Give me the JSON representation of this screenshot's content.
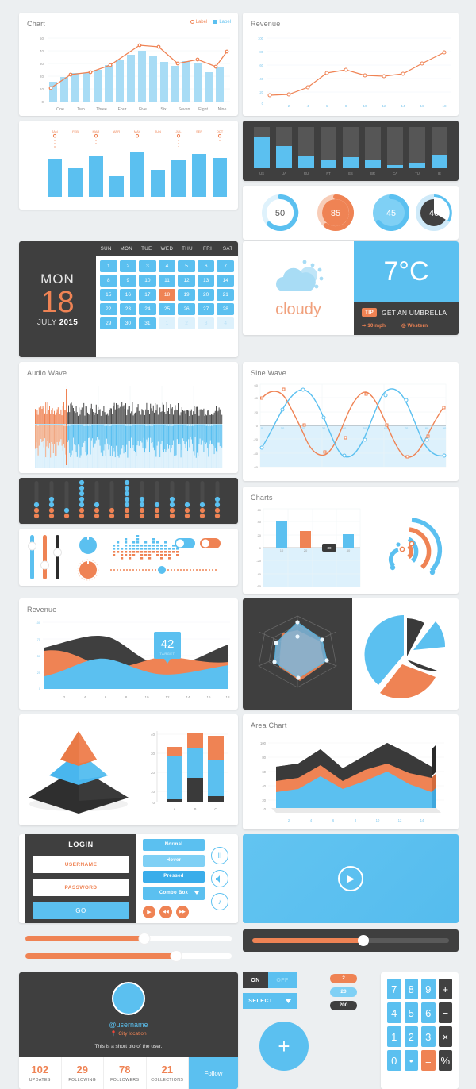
{
  "chart_panel": {
    "title": "Chart",
    "legend": [
      {
        "label": "Label",
        "style": "circle",
        "color": "#ef8354"
      },
      {
        "label": "Label",
        "style": "square",
        "color": "#5bc0f0"
      }
    ]
  },
  "chart_data": [
    {
      "type": "bar",
      "id": "chart",
      "title": "Chart",
      "categories": [
        "One",
        "Two",
        "Three",
        "Four",
        "Five",
        "Six",
        "Seven",
        "Eight",
        "Nine"
      ],
      "ytick_labels": [
        "0",
        "10",
        "20",
        "30",
        "40",
        "50"
      ],
      "ylim": [
        0,
        50
      ],
      "series": [
        {
          "name": "Label",
          "type": "bar",
          "color": "#a8dcf5",
          "values": [
            8,
            12,
            15,
            15,
            17,
            21,
            33,
            37,
            40,
            36,
            30,
            28,
            32,
            30,
            23,
            27,
            34
          ]
        },
        {
          "name": "Label",
          "type": "line",
          "color": "#ef8354",
          "values": [
            11,
            21,
            23,
            29,
            45,
            44,
            30,
            33,
            28,
            40
          ]
        }
      ],
      "xlabel": "",
      "ylabel": "",
      "grid": true,
      "legend_position": "top-right"
    },
    {
      "type": "line",
      "id": "revenue-line",
      "title": "Revenue",
      "x": [
        1,
        2,
        4,
        6,
        8,
        10,
        12,
        14,
        16,
        18
      ],
      "xtick_labels": [
        "",
        "2",
        "4",
        "6",
        "8",
        "10",
        "12",
        "14",
        "16",
        "18"
      ],
      "ytick_labels": [
        "0",
        "20",
        "40",
        "60",
        "80",
        "100"
      ],
      "ylim": [
        0,
        100
      ],
      "values": [
        11,
        13,
        24,
        46,
        50,
        43,
        41,
        44,
        58,
        72
      ],
      "color": "#ef8354",
      "grid": true
    },
    {
      "type": "bar",
      "id": "country-bars",
      "categories": [
        "US",
        "UA",
        "RU",
        "PT",
        "ES",
        "BR",
        "CA",
        "TU",
        "IE"
      ],
      "values": [
        78,
        53,
        30,
        20,
        27,
        21,
        8,
        14,
        32
      ],
      "track_max": 100,
      "bar_color": "#5bc0f0",
      "track_color": "#565656",
      "background": "#3f3f3f"
    },
    {
      "type": "gauge",
      "id": "donuts",
      "items": [
        {
          "value": 50,
          "ring": "#5bc0f0",
          "track": "#dff2fc",
          "fill": "#ffffff",
          "text": "#555555"
        },
        {
          "value": 85,
          "ring": "#ef8354",
          "track": "#f8cdb8",
          "fill": "#ef8354",
          "text": "#ffffff"
        },
        {
          "value": 45,
          "ring": "#5bc0f0",
          "track": "#7fd0f5",
          "fill": "#7fd0f5",
          "text": "#ffffff"
        },
        {
          "value": 40,
          "ring": "#5bc0f0",
          "track": "#cfeaf9",
          "fill": "#414141",
          "text": "#ffffff"
        }
      ]
    },
    {
      "type": "line",
      "id": "sine-wave",
      "title": "Sine Wave",
      "xtick_labels": [
        "0",
        "10",
        "20",
        "30",
        "40",
        "50",
        "60",
        "70",
        "80",
        "90"
      ],
      "ytick_labels": [
        "-60",
        "-40",
        "-20",
        "0",
        "20",
        "40",
        "60"
      ],
      "ylim": [
        -60,
        60
      ],
      "xlim": [
        0,
        90
      ],
      "series": [
        {
          "name": "wave-a",
          "color": "#ef8354",
          "values": [
            40,
            52,
            48,
            5,
            -42,
            -45,
            -22,
            42,
            52,
            48,
            2,
            -45,
            -46,
            -20
          ]
        },
        {
          "name": "wave-b",
          "color": "#5bc0f0",
          "values": [
            -31,
            27,
            55,
            18,
            -39,
            -41,
            -33,
            30,
            55,
            48,
            16,
            -38
          ]
        }
      ],
      "grid": true
    },
    {
      "type": "bar",
      "id": "charts-bar",
      "title": "Charts",
      "categories": [
        "10",
        "20",
        "30",
        "40"
      ],
      "values": [
        40,
        26,
        0,
        21
      ],
      "colors": [
        "#5bc0f0",
        "#ef8354",
        "#3a3a3a",
        "#5bc0f0"
      ],
      "highlighted_category": "30",
      "ytick_labels": [
        "-60",
        "-40",
        "-20",
        "0",
        "20",
        "40",
        "60"
      ],
      "ylim": [
        -60,
        60
      ],
      "grid": true
    },
    {
      "type": "area",
      "id": "revenue-area",
      "title": "Revenue",
      "xtick_labels": [
        "2",
        "4",
        "6",
        "8",
        "10",
        "12",
        "14",
        "16",
        "18"
      ],
      "ytick_labels": [
        "0",
        "25",
        "50",
        "75",
        "100"
      ],
      "ylim": [
        0,
        100
      ],
      "annotation": {
        "value": "42",
        "label": "TARGET",
        "color": "#5bc0f0"
      },
      "series": [
        {
          "name": "series-blue",
          "color": "#5bc0f0",
          "values": [
            22,
            30,
            38,
            44,
            47,
            44,
            38,
            33,
            31,
            34,
            38,
            40,
            38,
            36,
            38,
            42
          ]
        },
        {
          "name": "series-orange",
          "color": "#ef8354",
          "values": [
            52,
            50,
            46,
            42,
            40,
            42,
            44,
            41,
            36,
            46,
            52,
            50,
            44,
            40,
            44,
            50
          ]
        },
        {
          "name": "series-dark",
          "color": "#3f3f3f",
          "values": [
            52,
            50,
            48,
            50,
            58,
            66,
            70,
            68,
            60,
            52,
            50,
            50,
            48,
            50,
            56,
            62
          ]
        }
      ]
    },
    {
      "type": "radar",
      "id": "radar",
      "axes": 7,
      "series": [
        {
          "name": "radar-orange",
          "color": "#ef8354",
          "values": [
            0.45,
            0.85,
            0.55,
            0.8,
            0.6,
            0.45,
            0.5
          ]
        },
        {
          "name": "radar-blue",
          "color": "#7fb8dd",
          "values": [
            0.75,
            0.5,
            0.85,
            0.55,
            0.8,
            0.7,
            0.6
          ]
        }
      ],
      "background": "#3f3f3f"
    },
    {
      "type": "pie",
      "id": "pie-exploded",
      "slices": [
        {
          "name": "slice-blue-large",
          "value": 33,
          "color": "#5bc0f0"
        },
        {
          "name": "slice-dark",
          "value": 17,
          "color": "#3a3a3a"
        },
        {
          "name": "slice-blue-small",
          "value": 17,
          "color": "#5bc0f0"
        },
        {
          "name": "slice-orange",
          "value": 33,
          "color": "#ef8354"
        }
      ]
    },
    {
      "type": "pie",
      "id": "pyramid",
      "slices": [
        {
          "name": "tier-top",
          "value": 1,
          "color": "#ef8354"
        },
        {
          "name": "tier-mid",
          "value": 2,
          "color": "#5bc0f0"
        },
        {
          "name": "tier-base",
          "value": 3,
          "color": "#3a3a3a"
        }
      ]
    },
    {
      "type": "bar",
      "id": "stacked-bars",
      "categories": [
        "A",
        "B",
        "C"
      ],
      "ytick_labels": [
        "0",
        "10",
        "20",
        "30",
        "40"
      ],
      "ylim": [
        0,
        40
      ],
      "series": [
        {
          "name": "dark",
          "color": "#3a3a3a",
          "values": [
            1.5,
            13,
            3
          ]
        },
        {
          "name": "blue",
          "color": "#5bc0f0",
          "values": [
            22.5,
            16,
            19
          ]
        },
        {
          "name": "orange",
          "color": "#ef8354",
          "values": [
            5,
            8,
            14
          ]
        }
      ],
      "stacked": true
    },
    {
      "type": "area",
      "id": "area-chart-3d",
      "title": "Area Chart",
      "xtick_labels": [
        "2",
        "4",
        "6",
        "8",
        "10",
        "12",
        "14"
      ],
      "ytick_labels": [
        "0",
        "20",
        "40",
        "60",
        "80",
        "100"
      ],
      "ylim": [
        0,
        100
      ],
      "series": [
        {
          "name": "blue",
          "color": "#5bc0f0",
          "values": [
            28,
            32,
            35,
            52,
            46,
            38,
            45,
            52,
            57,
            42,
            33,
            32
          ]
        },
        {
          "name": "orange",
          "color": "#ef8354",
          "values": [
            42,
            46,
            50,
            70,
            62,
            56,
            72,
            76,
            72,
            62,
            58,
            76
          ]
        },
        {
          "name": "dark",
          "color": "#3a3a3a",
          "values": [
            62,
            64,
            66,
            98,
            88,
            80,
            96,
            100,
            94,
            82,
            80,
            100
          ]
        }
      ]
    },
    {
      "type": "bar",
      "id": "audio-wave",
      "title": "Audio Wave",
      "xtick_labels": [
        "0",
        "00:10",
        "00:20",
        "00:30",
        "00:40",
        "00:50",
        "01:00",
        "01:10",
        "01:20",
        "01:30"
      ],
      "playhead": "00:15",
      "colors": {
        "played": "#ef8354",
        "unplayed": "#4d4d4d",
        "mirror": "#5bc0f0"
      }
    }
  ],
  "calendar": {
    "weekday": "MON",
    "day": "18",
    "month": "JULY",
    "year": "2015",
    "day_headers": [
      "SUN",
      "MON",
      "TUE",
      "WED",
      "THU",
      "FRI",
      "SAT"
    ],
    "days": [
      "1",
      "2",
      "3",
      "4",
      "5",
      "6",
      "7",
      "8",
      "9",
      "10",
      "11",
      "12",
      "13",
      "14",
      "15",
      "16",
      "17",
      "18",
      "19",
      "20",
      "21",
      "22",
      "23",
      "24",
      "25",
      "26",
      "27",
      "28",
      "29",
      "30",
      "31",
      "1",
      "2",
      "3",
      "4"
    ],
    "today": "18",
    "muted_from_index": 31
  },
  "weather": {
    "condition": "cloudy",
    "icon": "cloud-sun-icon",
    "temperature": "7°C",
    "tip_badge": "TIP",
    "tip_text": "GET AN UMBRELLA",
    "wind_speed": "10 mph",
    "wind_direction": "Western"
  },
  "login": {
    "title": "LOGIN",
    "username_placeholder": "USERNAME",
    "password_placeholder": "PASSWORD",
    "submit_label": "GO"
  },
  "buttons": {
    "normal": "Normal",
    "hover": "Hover",
    "pressed": "Pressed",
    "combo": "Combo Box"
  },
  "media_controls": {
    "play": "▶",
    "rewind": "◀◀",
    "forward": "▶▶",
    "pause": "II",
    "volume": "🔊",
    "music": "♪"
  },
  "sliders": {
    "vertical": [
      {
        "name": "slider-blue",
        "color": "#5bc0f0",
        "value": 62
      },
      {
        "name": "slider-orange",
        "color": "#ef8354",
        "value": 32
      },
      {
        "name": "slider-dark",
        "color": "#2b2b2b",
        "value": 55
      }
    ],
    "knobs": [
      {
        "name": "knob-blue",
        "color": "#5bc0f0",
        "angle": 0
      },
      {
        "name": "knob-orange",
        "color": "#ef8354",
        "angle": 40
      }
    ],
    "horizontal": [
      {
        "name": "range-slider-top",
        "value": 55,
        "color": "#ef8354"
      },
      {
        "name": "range-slider-bottom",
        "value": 72,
        "color": "#ef8354"
      }
    ],
    "dotted_slider_value": 48,
    "toggles": [
      {
        "name": "toggle-blue",
        "state": "on",
        "color": "#5bc0f0"
      },
      {
        "name": "toggle-orange",
        "state": "on",
        "color": "#ef8354"
      }
    ]
  },
  "video_player": {
    "play_icon": "▶",
    "progress": 56
  },
  "profile": {
    "username": "@username",
    "location": "City location",
    "bio": "This is a short bio of the user.",
    "follow_label": "Follow",
    "stats": [
      {
        "value": "102",
        "label": "UPDATES"
      },
      {
        "value": "29",
        "label": "FOLLOWING"
      },
      {
        "value": "78",
        "label": "FOLLOWERS"
      },
      {
        "value": "21",
        "label": "COLLECTIONS"
      }
    ]
  },
  "switches": {
    "on_label": "ON",
    "off_label": "OFF",
    "select_label": "SELECT",
    "badges": [
      {
        "value": "2",
        "color": "#ef8354"
      },
      {
        "value": "20",
        "color": "#7fd0f5"
      },
      {
        "value": "200",
        "color": "#3f3f3f"
      }
    ]
  },
  "fab": {
    "icon": "+"
  },
  "calculator": {
    "keys": [
      {
        "label": "7",
        "type": "num"
      },
      {
        "label": "8",
        "type": "num"
      },
      {
        "label": "9",
        "type": "num"
      },
      {
        "label": "+",
        "type": "op"
      },
      {
        "label": "4",
        "type": "num"
      },
      {
        "label": "5",
        "type": "num"
      },
      {
        "label": "6",
        "type": "num"
      },
      {
        "label": "−",
        "type": "op"
      },
      {
        "label": "1",
        "type": "num"
      },
      {
        "label": "2",
        "type": "num"
      },
      {
        "label": "3",
        "type": "num"
      },
      {
        "label": "×",
        "type": "op"
      },
      {
        "label": "0",
        "type": "num"
      },
      {
        "label": "•",
        "type": "num"
      },
      {
        "label": "=",
        "type": "eq"
      },
      {
        "label": "%",
        "type": "op"
      }
    ]
  },
  "equalizer": {
    "columns": 13,
    "dot_colors": {
      "high": "#5bc0f0",
      "low": "#ef8354"
    }
  }
}
